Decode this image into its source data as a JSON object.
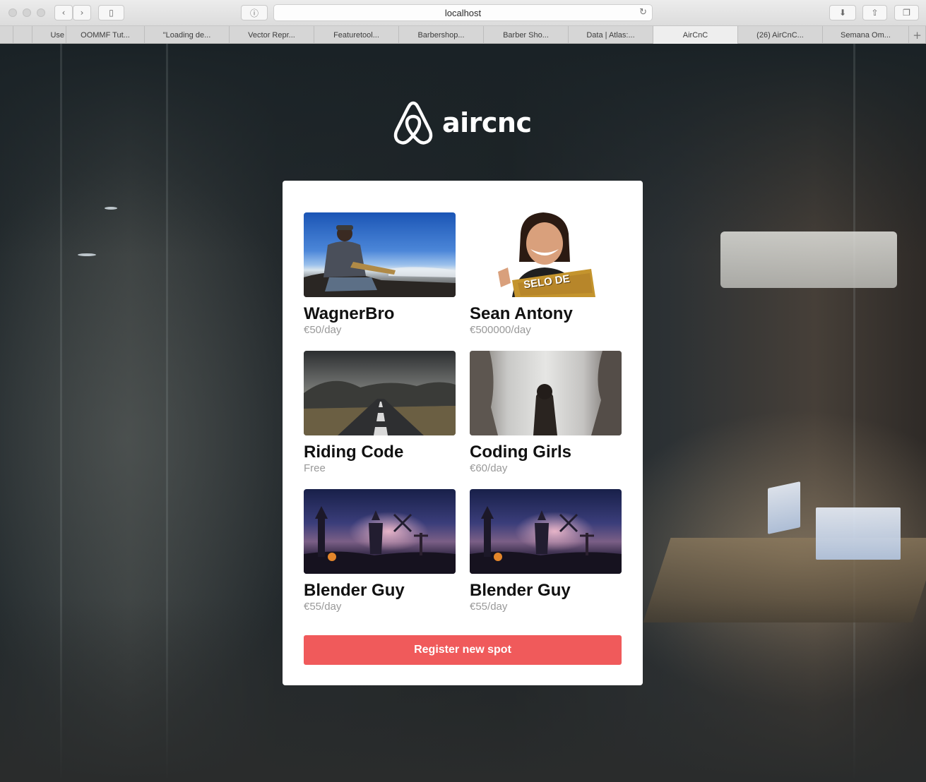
{
  "browser": {
    "url": "localhost",
    "tabs": [
      {
        "label": "",
        "active": false
      },
      {
        "label": "Use",
        "active": false
      },
      {
        "label": "OOMMF Tut...",
        "active": false
      },
      {
        "label": "\"Loading de...",
        "active": false
      },
      {
        "label": "Vector Repr...",
        "active": false
      },
      {
        "label": "Featuretool...",
        "active": false
      },
      {
        "label": "Barbershop...",
        "active": false
      },
      {
        "label": "Barber Sho...",
        "active": false
      },
      {
        "label": "Data | Atlas:...",
        "active": false
      },
      {
        "label": "AirCnC",
        "active": true
      },
      {
        "label": "(26) AirCnC...",
        "active": false
      },
      {
        "label": "Semana Om...",
        "active": false
      }
    ],
    "new_tab_label": "+"
  },
  "brand": {
    "name": "aircnc",
    "color": "#ffffff"
  },
  "spots": [
    {
      "name": "WagnerBro",
      "price": "€50/day",
      "image": "guitarist-by-sea"
    },
    {
      "name": "Sean Antony",
      "price": "€500000/day",
      "image": "smiling-man-badge",
      "image_text": "SELO DE"
    },
    {
      "name": "Riding Code",
      "price": "Free",
      "image": "mountain-road"
    },
    {
      "name": "Coding Girls",
      "price": "€60/day",
      "image": "hooded-figure-mist"
    },
    {
      "name": "Blender Guy",
      "price": "€55/day",
      "image": "halloween-night-scene"
    },
    {
      "name": "Blender Guy",
      "price": "€55/day",
      "image": "halloween-night-scene"
    }
  ],
  "register_button": {
    "label": "Register new spot",
    "color": "#f05a5b"
  }
}
